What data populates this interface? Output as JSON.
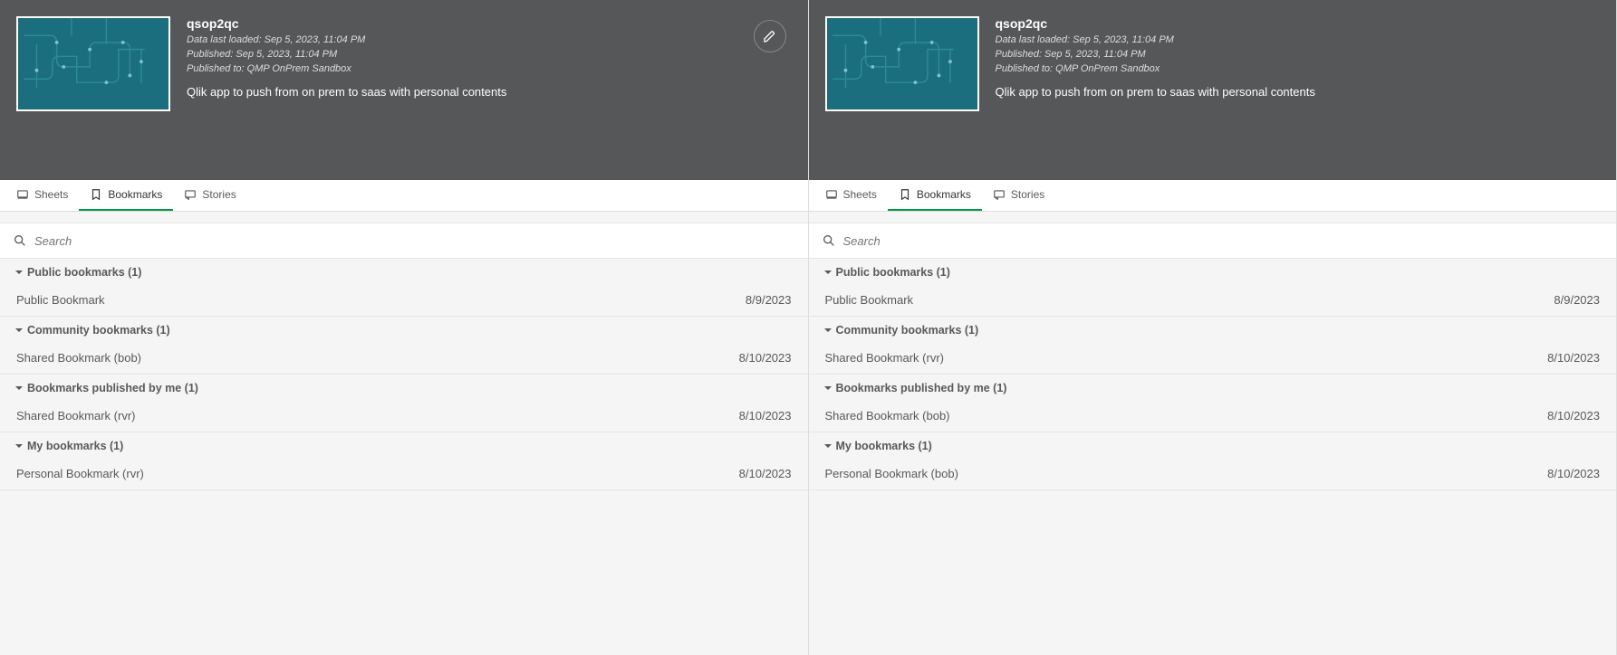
{
  "app": {
    "title": "qsop2qc",
    "lastLoaded": "Data last loaded: Sep 5, 2023, 11:04 PM",
    "published": "Published: Sep 5, 2023, 11:04 PM",
    "publishedTo": "Published to: QMP OnPrem Sandbox",
    "description": "Qlik app to push from on prem to saas with personal contents"
  },
  "tabs": {
    "sheets": "Sheets",
    "bookmarks": "Bookmarks",
    "stories": "Stories"
  },
  "search": {
    "placeholder": "Search"
  },
  "left": {
    "groups": [
      {
        "title": "Public bookmarks (1)",
        "items": [
          {
            "label": "Public Bookmark",
            "date": "8/9/2023"
          }
        ]
      },
      {
        "title": "Community bookmarks (1)",
        "items": [
          {
            "label": "Shared Bookmark (bob)",
            "date": "8/10/2023"
          }
        ]
      },
      {
        "title": "Bookmarks published by me (1)",
        "items": [
          {
            "label": "Shared Bookmark (rvr)",
            "date": "8/10/2023"
          }
        ]
      },
      {
        "title": "My bookmarks (1)",
        "items": [
          {
            "label": "Personal Bookmark (rvr)",
            "date": "8/10/2023"
          }
        ]
      }
    ]
  },
  "right": {
    "groups": [
      {
        "title": "Public bookmarks (1)",
        "items": [
          {
            "label": "Public Bookmark",
            "date": "8/9/2023"
          }
        ]
      },
      {
        "title": "Community bookmarks (1)",
        "items": [
          {
            "label": "Shared Bookmark (rvr)",
            "date": "8/10/2023"
          }
        ]
      },
      {
        "title": "Bookmarks published by me (1)",
        "items": [
          {
            "label": "Shared Bookmark (bob)",
            "date": "8/10/2023"
          }
        ]
      },
      {
        "title": "My bookmarks (1)",
        "items": [
          {
            "label": "Personal Bookmark (bob)",
            "date": "8/10/2023"
          }
        ]
      }
    ]
  }
}
